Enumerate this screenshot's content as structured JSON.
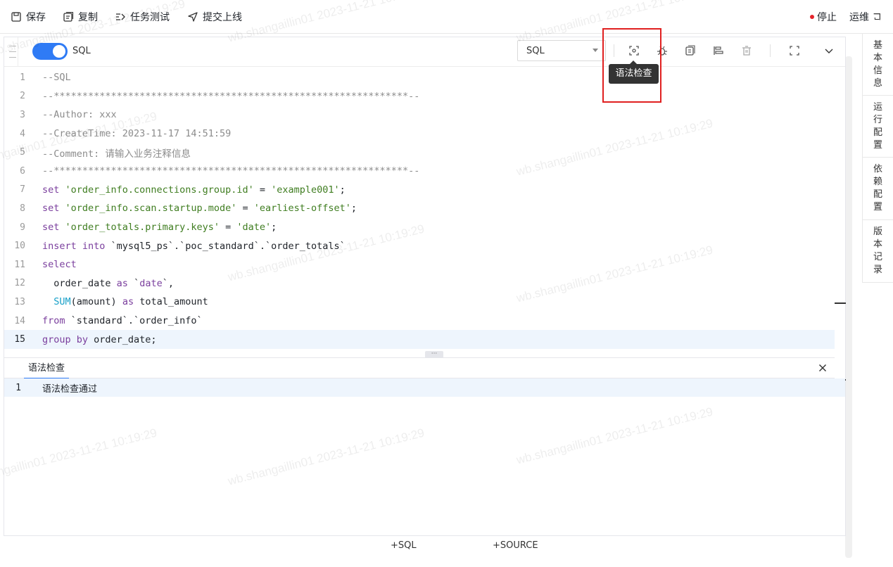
{
  "toolbar": {
    "save": "保存",
    "copy": "复制",
    "task_test": "任务测试",
    "submit": "提交上线",
    "stop": "停止",
    "ops": "运维"
  },
  "side_tabs": [
    "基本信息",
    "运行配置",
    "依赖配置",
    "版本记录"
  ],
  "editor": {
    "toggle_label": "SQL",
    "toggle_on": true,
    "language_select": "SQL",
    "tooltip": "语法检查"
  },
  "code_lines": [
    {
      "n": "1",
      "tokens": [
        {
          "t": "--SQL",
          "c": "comment"
        }
      ]
    },
    {
      "n": "2",
      "tokens": [
        {
          "t": "--**************************************************************--",
          "c": "comment"
        }
      ]
    },
    {
      "n": "3",
      "tokens": [
        {
          "t": "--Author: xxx",
          "c": "comment"
        }
      ]
    },
    {
      "n": "4",
      "tokens": [
        {
          "t": "--CreateTime: 2023-11-17 14:51:59",
          "c": "comment"
        }
      ]
    },
    {
      "n": "5",
      "tokens": [
        {
          "t": "--Comment: 请输入业务注释信息",
          "c": "comment"
        }
      ]
    },
    {
      "n": "6",
      "tokens": [
        {
          "t": "--**************************************************************--",
          "c": "comment"
        }
      ]
    },
    {
      "n": "7",
      "tokens": [
        {
          "t": "set ",
          "c": "kw"
        },
        {
          "t": "'order_info.connections.group.id'",
          "c": "str"
        },
        {
          "t": " = ",
          "c": "plain"
        },
        {
          "t": "'example001'",
          "c": "str"
        },
        {
          "t": ";",
          "c": "plain"
        }
      ]
    },
    {
      "n": "8",
      "tokens": [
        {
          "t": "set ",
          "c": "kw"
        },
        {
          "t": "'order_info.scan.startup.mode'",
          "c": "str"
        },
        {
          "t": " = ",
          "c": "plain"
        },
        {
          "t": "'earliest-offset'",
          "c": "str"
        },
        {
          "t": ";",
          "c": "plain"
        }
      ]
    },
    {
      "n": "9",
      "tokens": [
        {
          "t": "set ",
          "c": "kw"
        },
        {
          "t": "'order_totals.primary.keys'",
          "c": "str"
        },
        {
          "t": " = ",
          "c": "plain"
        },
        {
          "t": "'date'",
          "c": "str"
        },
        {
          "t": ";",
          "c": "plain"
        }
      ]
    },
    {
      "n": "10",
      "tokens": [
        {
          "t": "insert into ",
          "c": "kw"
        },
        {
          "t": "`mysql5_ps`.`poc_standard`.`order_totals`",
          "c": "plain"
        }
      ]
    },
    {
      "n": "11",
      "tokens": [
        {
          "t": "select",
          "c": "kw"
        }
      ]
    },
    {
      "n": "12",
      "tokens": [
        {
          "t": "  order_date ",
          "c": "plain"
        },
        {
          "t": "as ",
          "c": "kw"
        },
        {
          "t": "`",
          "c": "plain"
        },
        {
          "t": "date",
          "c": "kw"
        },
        {
          "t": "`,",
          "c": "plain"
        }
      ]
    },
    {
      "n": "13",
      "tokens": [
        {
          "t": "  ",
          "c": "plain"
        },
        {
          "t": "SUM",
          "c": "fn"
        },
        {
          "t": "(amount) ",
          "c": "plain"
        },
        {
          "t": "as ",
          "c": "kw"
        },
        {
          "t": "total_amount",
          "c": "plain"
        }
      ]
    },
    {
      "n": "14",
      "tokens": [
        {
          "t": "from ",
          "c": "kw"
        },
        {
          "t": "`standard`.`order_info`",
          "c": "plain"
        }
      ]
    },
    {
      "n": "15",
      "tokens": [
        {
          "t": "group by ",
          "c": "kw"
        },
        {
          "t": "order_date;",
          "c": "plain"
        }
      ],
      "active": true
    }
  ],
  "result": {
    "tab": "语法检查",
    "rows": [
      {
        "n": "1",
        "text": "语法检查通过"
      }
    ]
  },
  "footer": {
    "add_sql": "+SQL",
    "add_source": "+SOURCE"
  },
  "watermark": {
    "texts": [
      "wb.shangaillin01 2023-11-21 10:19:29",
      "wb.shangaillin01 2023-11-21 10:19:29",
      "wb.shangaillin01 2023-11-21 10:19:29",
      "wb.shangaillin01 2023-11-21 10:19:29",
      "wb.shangaillin01 2023-11-21 10:19:29",
      "wb.shangaillin01 2023-11-21 10:19:29",
      "wb.shangaillin01 2023-11-21 10:19:29",
      "wb.shangaillin01 2023-11-21 10:19:29",
      "wb.shangaillin01 2023-11-21 10:19:29",
      "wb.shangaillin01 2023-11-21 10:19:29"
    ]
  },
  "colors": {
    "accent": "#2f7bf5",
    "stop_dot": "#e5232b",
    "highlight_box": "#e02020",
    "active_line_bg": "#eef5fd"
  }
}
